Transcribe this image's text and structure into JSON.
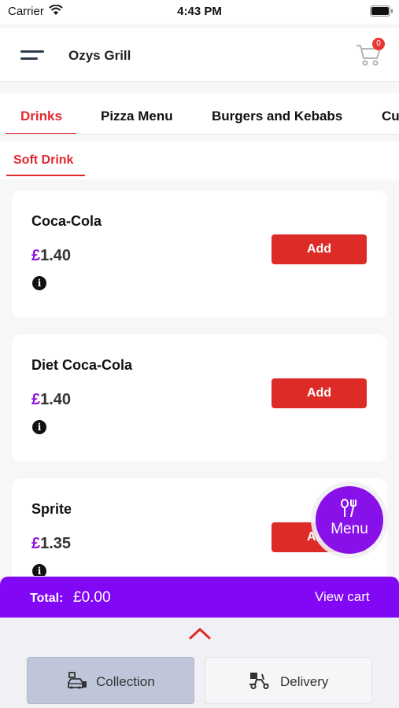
{
  "status_bar": {
    "carrier": "Carrier",
    "time": "4:43 PM"
  },
  "header": {
    "title": "Ozys Grill",
    "cart_count": "0"
  },
  "categories": [
    {
      "label": "Drinks",
      "active": true
    },
    {
      "label": "Pizza Menu",
      "active": false
    },
    {
      "label": "Burgers and Kebabs",
      "active": false
    },
    {
      "label": "Cu",
      "active": false
    }
  ],
  "subcategory": {
    "label": "Soft Drink"
  },
  "products": [
    {
      "name": "Coca-Cola",
      "currency": "£",
      "price": "1.40",
      "add_label": "Add"
    },
    {
      "name": "Diet Coca-Cola",
      "currency": "£",
      "price": "1.40",
      "add_label": "Add"
    },
    {
      "name": "Sprite",
      "currency": "£",
      "price": "1.35",
      "add_label": "Add"
    }
  ],
  "menu_fab": {
    "label": "Menu"
  },
  "totals": {
    "label": "Total:",
    "value": "£0.00",
    "view_cart": "View cart"
  },
  "order_modes": {
    "collection": "Collection",
    "delivery": "Delivery"
  },
  "colors": {
    "accent_red": "#dd2b27",
    "accent_purple": "#8207f5",
    "price_currency": "#8b1bd6"
  }
}
